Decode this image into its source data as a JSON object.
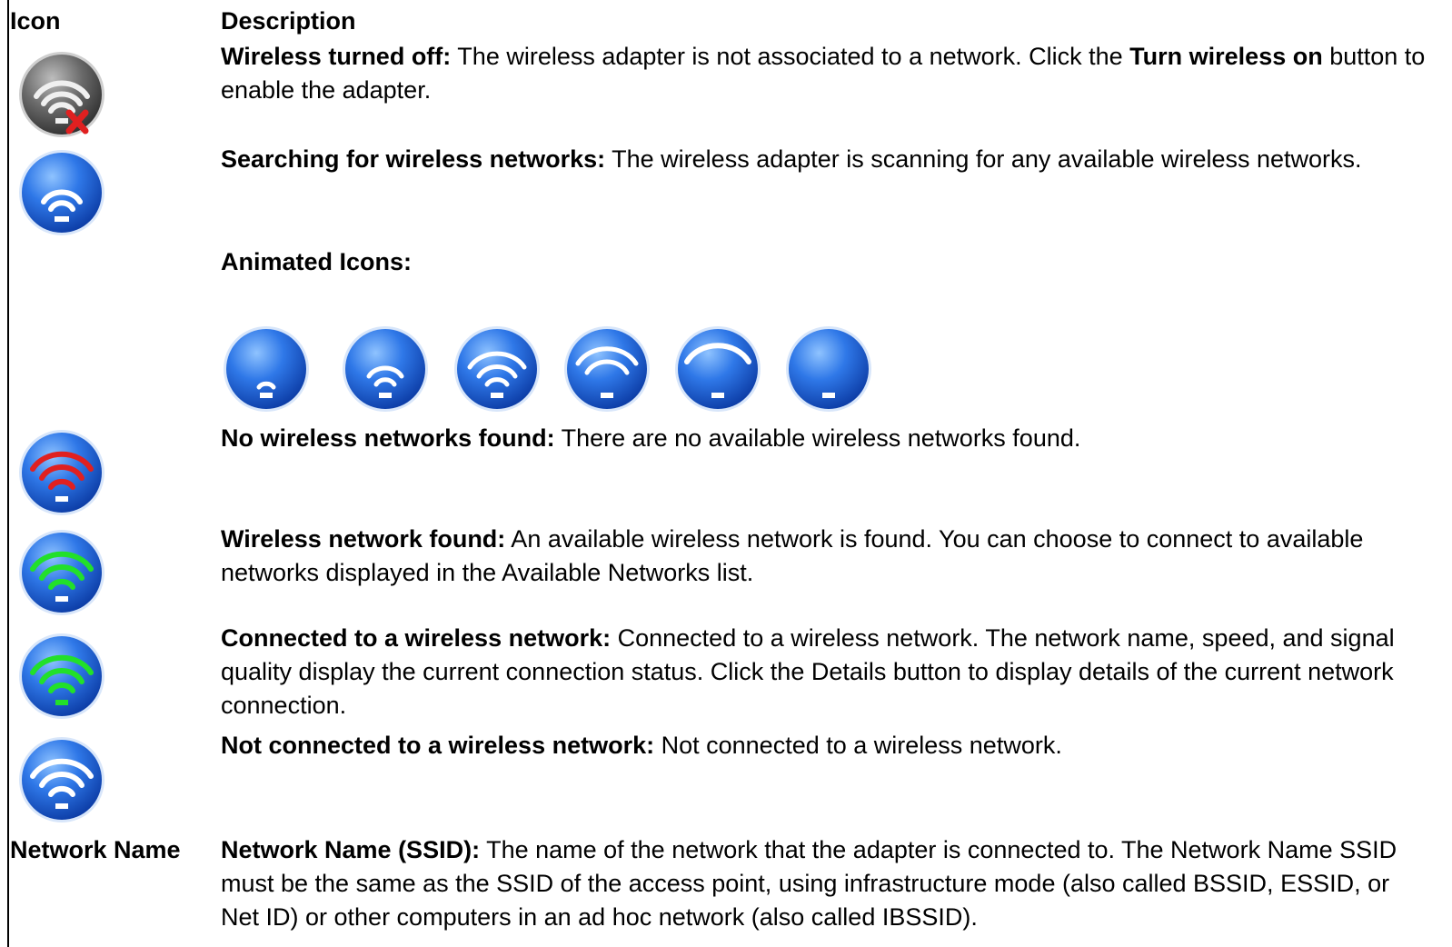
{
  "header": {
    "icon_col": "Icon",
    "desc_col": "Description"
  },
  "rows": [
    {
      "icon": "wireless-off-icon",
      "title": "Wireless turned off:",
      "text": " The wireless adapter is not associated to a network. Click the ",
      "bold2": "Turn wireless on",
      "text2": " button to enable the adapter."
    },
    {
      "icon": "wireless-searching-icon",
      "title": "Searching for wireless networks:",
      "text": " The wireless adapter is scanning for any available wireless networks."
    },
    {
      "title": "Animated Icons:",
      "animated_icons": [
        "signal-1-icon",
        "signal-2-icon",
        "signal-3-icon",
        "signal-4-icon",
        "signal-5-icon",
        "signal-empty-icon"
      ]
    },
    {
      "icon": "no-networks-icon",
      "title": "No wireless networks found:",
      "text": " There are no available wireless networks found."
    },
    {
      "icon": "network-found-icon",
      "title": "Wireless network found:",
      "text": " An available wireless network is found. You can choose to connect to available networks displayed in the Available Networks list."
    },
    {
      "icon": "connected-icon",
      "title": "Connected to a wireless network:",
      "text": " Connected to a wireless network. The network name, speed, and signal quality display the current connection status. Click the Details button to display details of the current network connection."
    },
    {
      "icon": "not-connected-icon",
      "title": "Not connected to a wireless network:",
      "text": " Not connected to a wireless network."
    },
    {
      "label": "Network Name",
      "title": "Network Name (SSID):",
      "text": " The name of the network that the adapter is connected to. The Network Name SSID must be the same as the SSID of the access point, using infrastructure mode (also called BSSID, ESSID, or Net ID) or other computers in an ad hoc network (also called IBSSID)."
    }
  ],
  "colors": {
    "blue": "#1e5fd6",
    "gray": "#555555",
    "red": "#e02020",
    "green": "#22e02a"
  }
}
